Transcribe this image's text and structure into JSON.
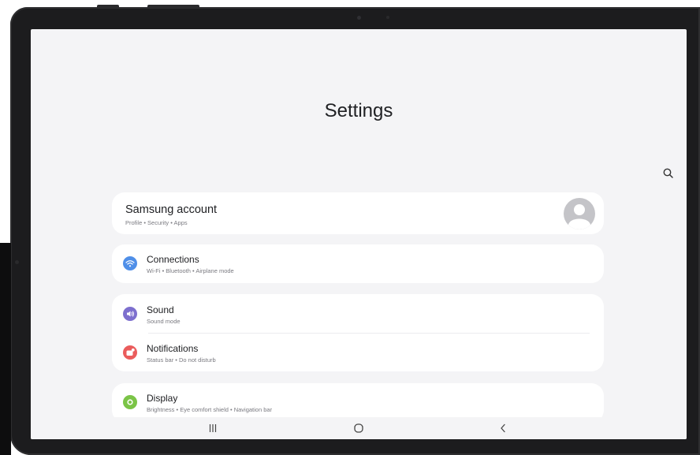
{
  "header": {
    "title": "Settings"
  },
  "search": {
    "icon": "search-icon"
  },
  "account": {
    "title": "Samsung account",
    "subtitle": "Profile  •  Security  •  Apps",
    "icon": "avatar-icon"
  },
  "items": [
    {
      "title": "Connections",
      "subtitle": "Wi-Fi  •  Bluetooth  •  Airplane mode",
      "icon": "wifi-icon",
      "color": "#4f8fe8"
    },
    {
      "title": "Sound",
      "subtitle": "Sound mode",
      "icon": "speaker-icon",
      "color": "#7d6fce"
    },
    {
      "title": "Notifications",
      "subtitle": "Status bar  •  Do not disturb",
      "icon": "notification-icon",
      "color": "#ea5c5c"
    },
    {
      "title": "Display",
      "subtitle": "Brightness  •  Eye comfort shield  •  Navigation bar",
      "icon": "brightness-icon",
      "color": "#7bc447"
    }
  ],
  "navbar": {
    "recents": "recents-icon",
    "home": "home-icon",
    "back": "back-icon"
  }
}
